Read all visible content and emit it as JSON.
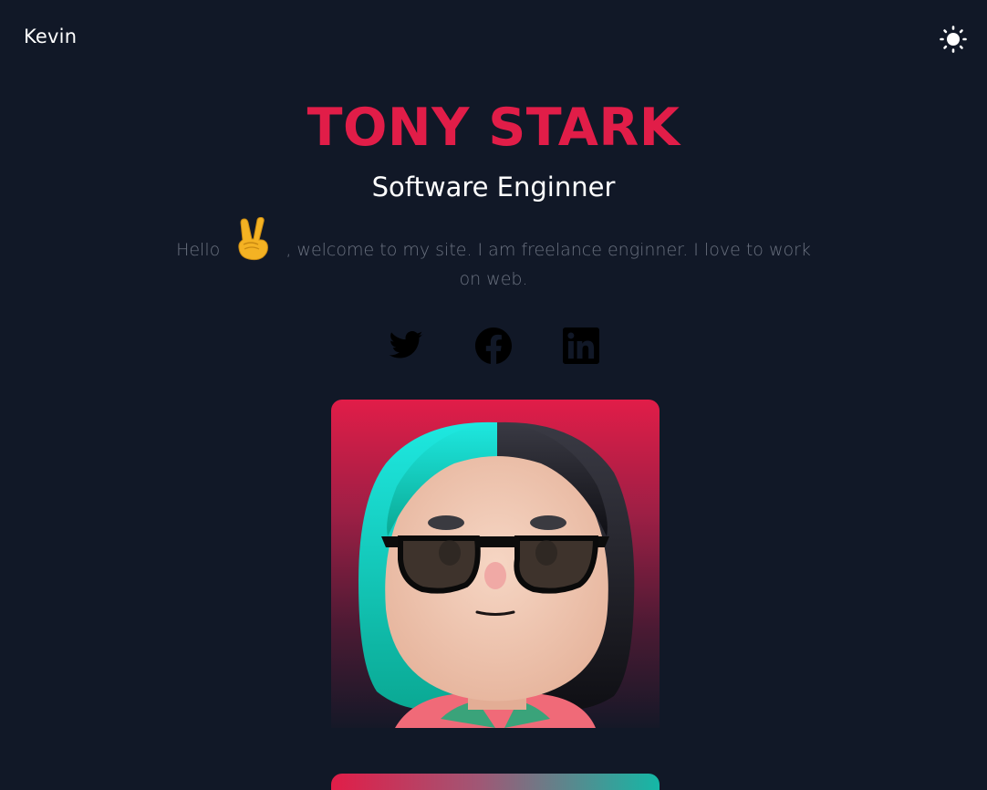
{
  "nav": {
    "brand": "Kevin",
    "theme_toggle_icon": "sun-icon"
  },
  "hero": {
    "name": "TONY STARK",
    "role": "Software Enginner",
    "intro_before": "Hello",
    "intro_emoji": "victory-hand-icon",
    "intro_after": ", welcome to my site. I am freelance enginner. I love to work on web."
  },
  "socials": [
    {
      "icon": "twitter-icon"
    },
    {
      "icon": "facebook-icon"
    },
    {
      "icon": "linkedin-icon"
    }
  ],
  "colors": {
    "background": "#111827",
    "accent": "#e11d48",
    "muted_text": "#6b7280",
    "teal": "#14b8a6"
  }
}
